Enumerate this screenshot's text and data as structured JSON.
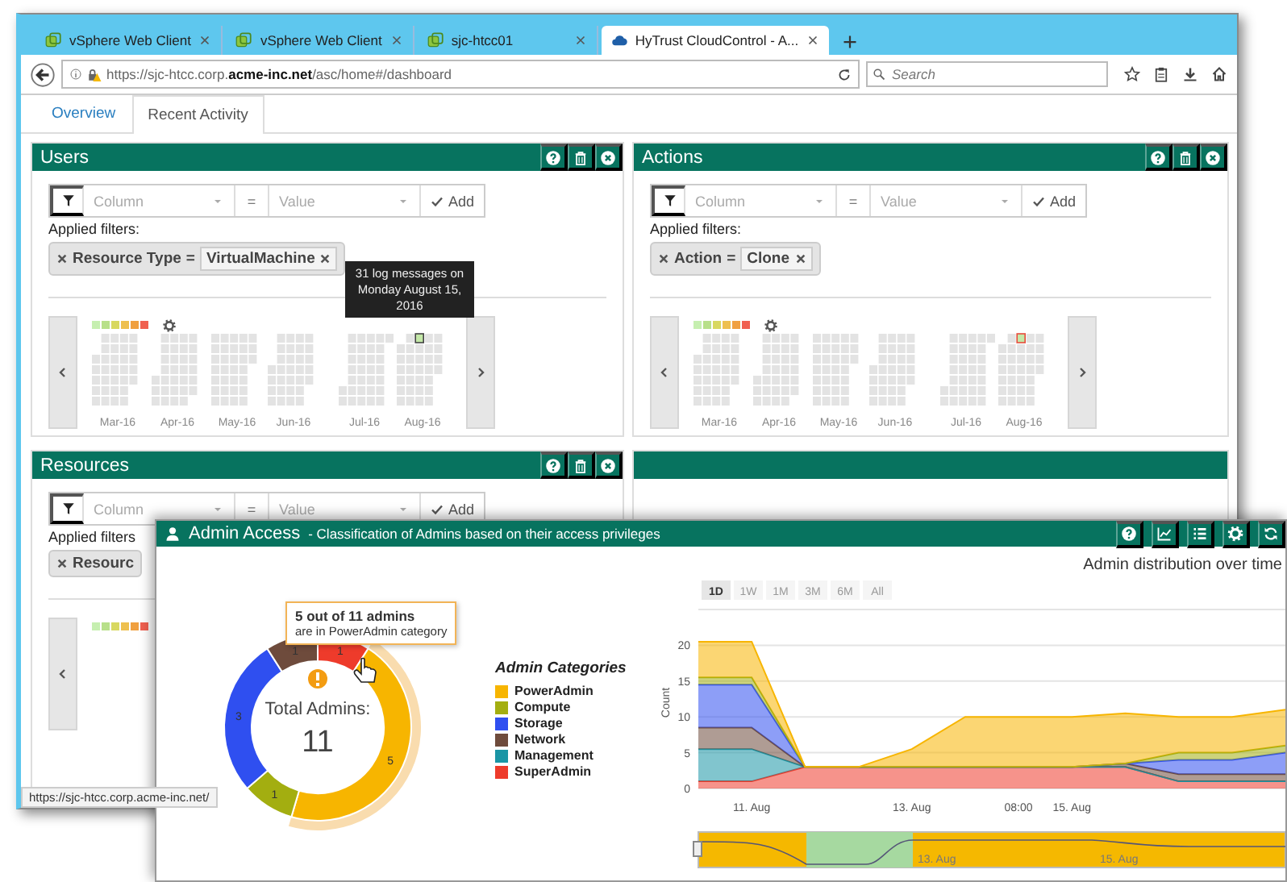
{
  "browser": {
    "tabs": [
      {
        "title": "vSphere Web Client",
        "kind": "vsphere",
        "selected": false
      },
      {
        "title": "vSphere Web Client",
        "kind": "vsphere",
        "selected": false
      },
      {
        "title": "sjc-htcc01",
        "kind": "vsphere",
        "selected": false
      },
      {
        "title": "HyTrust CloudControl - A...",
        "kind": "cloud",
        "selected": true
      }
    ],
    "address": "https://sjc-htcc.corp.**acme-inc.net**/asc/home#/dashboard",
    "search": {
      "placeholder": "Search"
    },
    "status": "https://sjc-htcc.corp.acme-inc.net/"
  },
  "page_tabs": [
    {
      "label": "Overview",
      "selected": false
    },
    {
      "label": "Recent Activity",
      "selected": true
    }
  ],
  "panels": [
    {
      "title": "Users",
      "filter_bar": {
        "column": "Column",
        "operator": "=",
        "value": "Value",
        "add": "Add"
      },
      "applied_label": "Applied filters:",
      "filters": [
        {
          "field": "Resource Type",
          "operator": "=",
          "value": "VirtualMachine"
        }
      ],
      "heatmap": {
        "months": [
          "Mar-16",
          "Apr-16",
          "May-16",
          "Jun-16",
          "Jul-16",
          "Aug-16"
        ],
        "tooltip": "31 log messages on Monday August 15, 2016"
      }
    },
    {
      "title": "Actions",
      "filter_bar": {
        "column": "Column",
        "operator": "=",
        "value": "Value",
        "add": "Add"
      },
      "applied_label": "Applied filters:",
      "filters": [
        {
          "field": "Action",
          "operator": "=",
          "value": "Clone"
        }
      ],
      "heatmap": {
        "months": [
          "Mar-16",
          "Apr-16",
          "May-16",
          "Jun-16",
          "Jul-16",
          "Aug-16"
        ]
      }
    },
    {
      "title": "Resources",
      "filter_bar": {
        "column": "Column",
        "operator": "=",
        "value": "Value",
        "add": "Add"
      },
      "applied_label": "Applied filters",
      "filters": [
        {
          "field": "Resourc"
        }
      ]
    }
  ],
  "admin_access": {
    "title": "Admin Access",
    "subtitle": "- Classification of Admins based on their access privileges",
    "donut": {
      "chart_data": {
        "type": "donut",
        "categories": [
          "PowerAdmin",
          "Compute",
          "Storage",
          "Network",
          "Management",
          "SuperAdmin"
        ],
        "values": [
          5,
          1,
          3,
          1,
          0,
          1
        ],
        "data_labels": true
      },
      "center_label": "Total Admins:",
      "center_value": "11",
      "tooltip": {
        "title": "5 out of 11 admins",
        "text": "are in PowerAdmin category"
      },
      "legend": {
        "title": "Admin Categories",
        "items": [
          {
            "color": "#f7b500"
          },
          {
            "color": "#a3ae10"
          },
          {
            "color": "#2f4ff0"
          },
          {
            "color": "#6e4b3c"
          },
          {
            "color": "#1a95a5"
          },
          {
            "color": "#ee3b2b"
          }
        ]
      }
    },
    "timeline": {
      "range_buttons": [
        {
          "label": "1D",
          "selected": true
        },
        {
          "label": "1W",
          "selected": false
        },
        {
          "label": "1M",
          "selected": false
        },
        {
          "label": "3M",
          "selected": false
        },
        {
          "label": "6M",
          "selected": false
        },
        {
          "label": "All",
          "selected": false
        }
      ],
      "navigator_labels": [
        "13. Aug",
        "15. Aug"
      ],
      "chart_data": {
        "type": "area",
        "stacked": true,
        "title": "Admin distribution over time",
        "ylabel": "Count",
        "grid": true,
        "categories": [
          null,
          "11. Aug",
          null,
          null,
          "13. Aug",
          null,
          "08:00",
          "15. Aug",
          null,
          null,
          null,
          null
        ],
        "ylim": [
          0,
          25
        ],
        "yticks": [
          0,
          5,
          10,
          15,
          20
        ],
        "series": [
          {
            "color": "#ee3b2b",
            "values": [
              1,
              1,
              3,
              3,
              3,
              3,
              3,
              3,
              3,
              1,
              1,
              1
            ]
          },
          {
            "color": "#1a95a5",
            "values": [
              4.5,
              4.5,
              0,
              0,
              0,
              0,
              0,
              0,
              0,
              0,
              0,
              0
            ]
          },
          {
            "color": "#6e4b3c",
            "values": [
              3,
              3,
              0,
              0,
              0,
              0,
              0,
              0,
              0.5,
              1,
              1,
              1
            ]
          },
          {
            "color": "#2f4ff0",
            "values": [
              6,
              6,
              0,
              0,
              0,
              0,
              0,
              0,
              0,
              2,
              2,
              3
            ]
          },
          {
            "color": "#a3ae10",
            "values": [
              1,
              1,
              0,
              0,
              0,
              0,
              0,
              0,
              0,
              1,
              1,
              1
            ]
          },
          {
            "color": "#f7b500",
            "values": [
              5,
              5,
              0,
              0,
              2.5,
              7,
              7,
              7,
              7,
              5,
              5,
              5
            ]
          }
        ]
      }
    }
  }
}
